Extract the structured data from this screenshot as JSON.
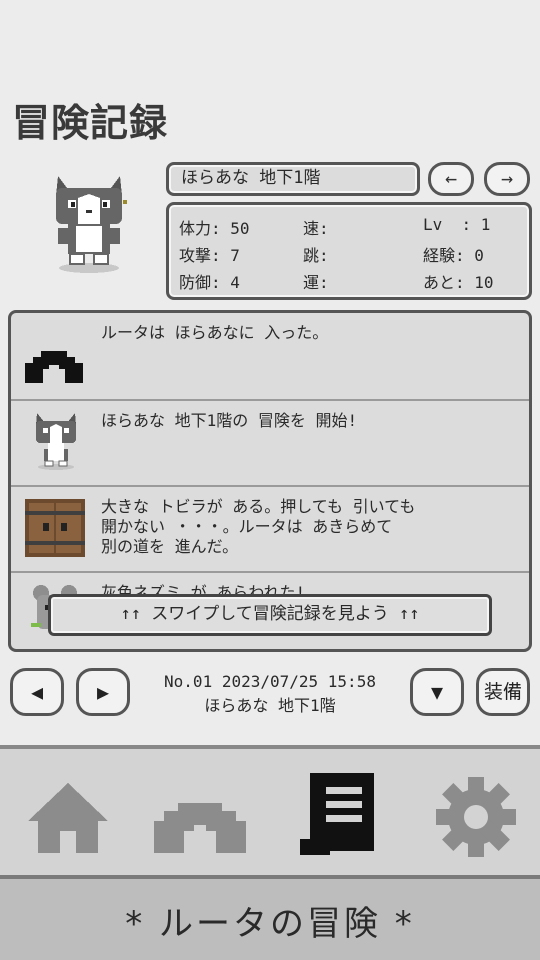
{
  "header": {
    "title": "冒険記録"
  },
  "location": {
    "name": "ほらあな 地下1階",
    "prev_label": "←",
    "next_label": "→"
  },
  "stats": {
    "hp": "体力: 50",
    "speed": "速:",
    "level": "Lv  : 1",
    "attack": "攻撃: 7",
    "jump": "跳:",
    "exp": "経験: 0",
    "defense": "防御: 4",
    "luck": "運:",
    "remaining": "あと: 10"
  },
  "log": {
    "entries": [
      {
        "icon": "cave-icon",
        "text": "ルータは ほらあなに 入った。"
      },
      {
        "icon": "cat-icon",
        "text": "ほらあな 地下1階の 冒険を 開始!"
      },
      {
        "icon": "door-icon",
        "text": "大きな トビラが ある。押しても 引いても\n開かない ・・・。ルータは あきらめて\n別の道を 進んだ。"
      },
      {
        "icon": "rat-icon",
        "text": "灰色ネズミ が あらわれた!"
      }
    ],
    "swipe_hint": "↑↑ スワイプして冒険記録を見よう ↑↑"
  },
  "record": {
    "number_date": "No.01  2023/07/25 15:58",
    "location": "ほらあな 地下1階",
    "prev_label": "◀",
    "next_label": "▶",
    "down_label": "▼",
    "equip_label": "装備"
  },
  "tabs": [
    {
      "name": "home",
      "icon": "home-icon"
    },
    {
      "name": "dungeon",
      "icon": "cave-icon"
    },
    {
      "name": "record",
      "icon": "scroll-icon"
    },
    {
      "name": "settings",
      "icon": "gear-icon"
    }
  ],
  "footer": {
    "title": "* ルータの冒険 *"
  }
}
